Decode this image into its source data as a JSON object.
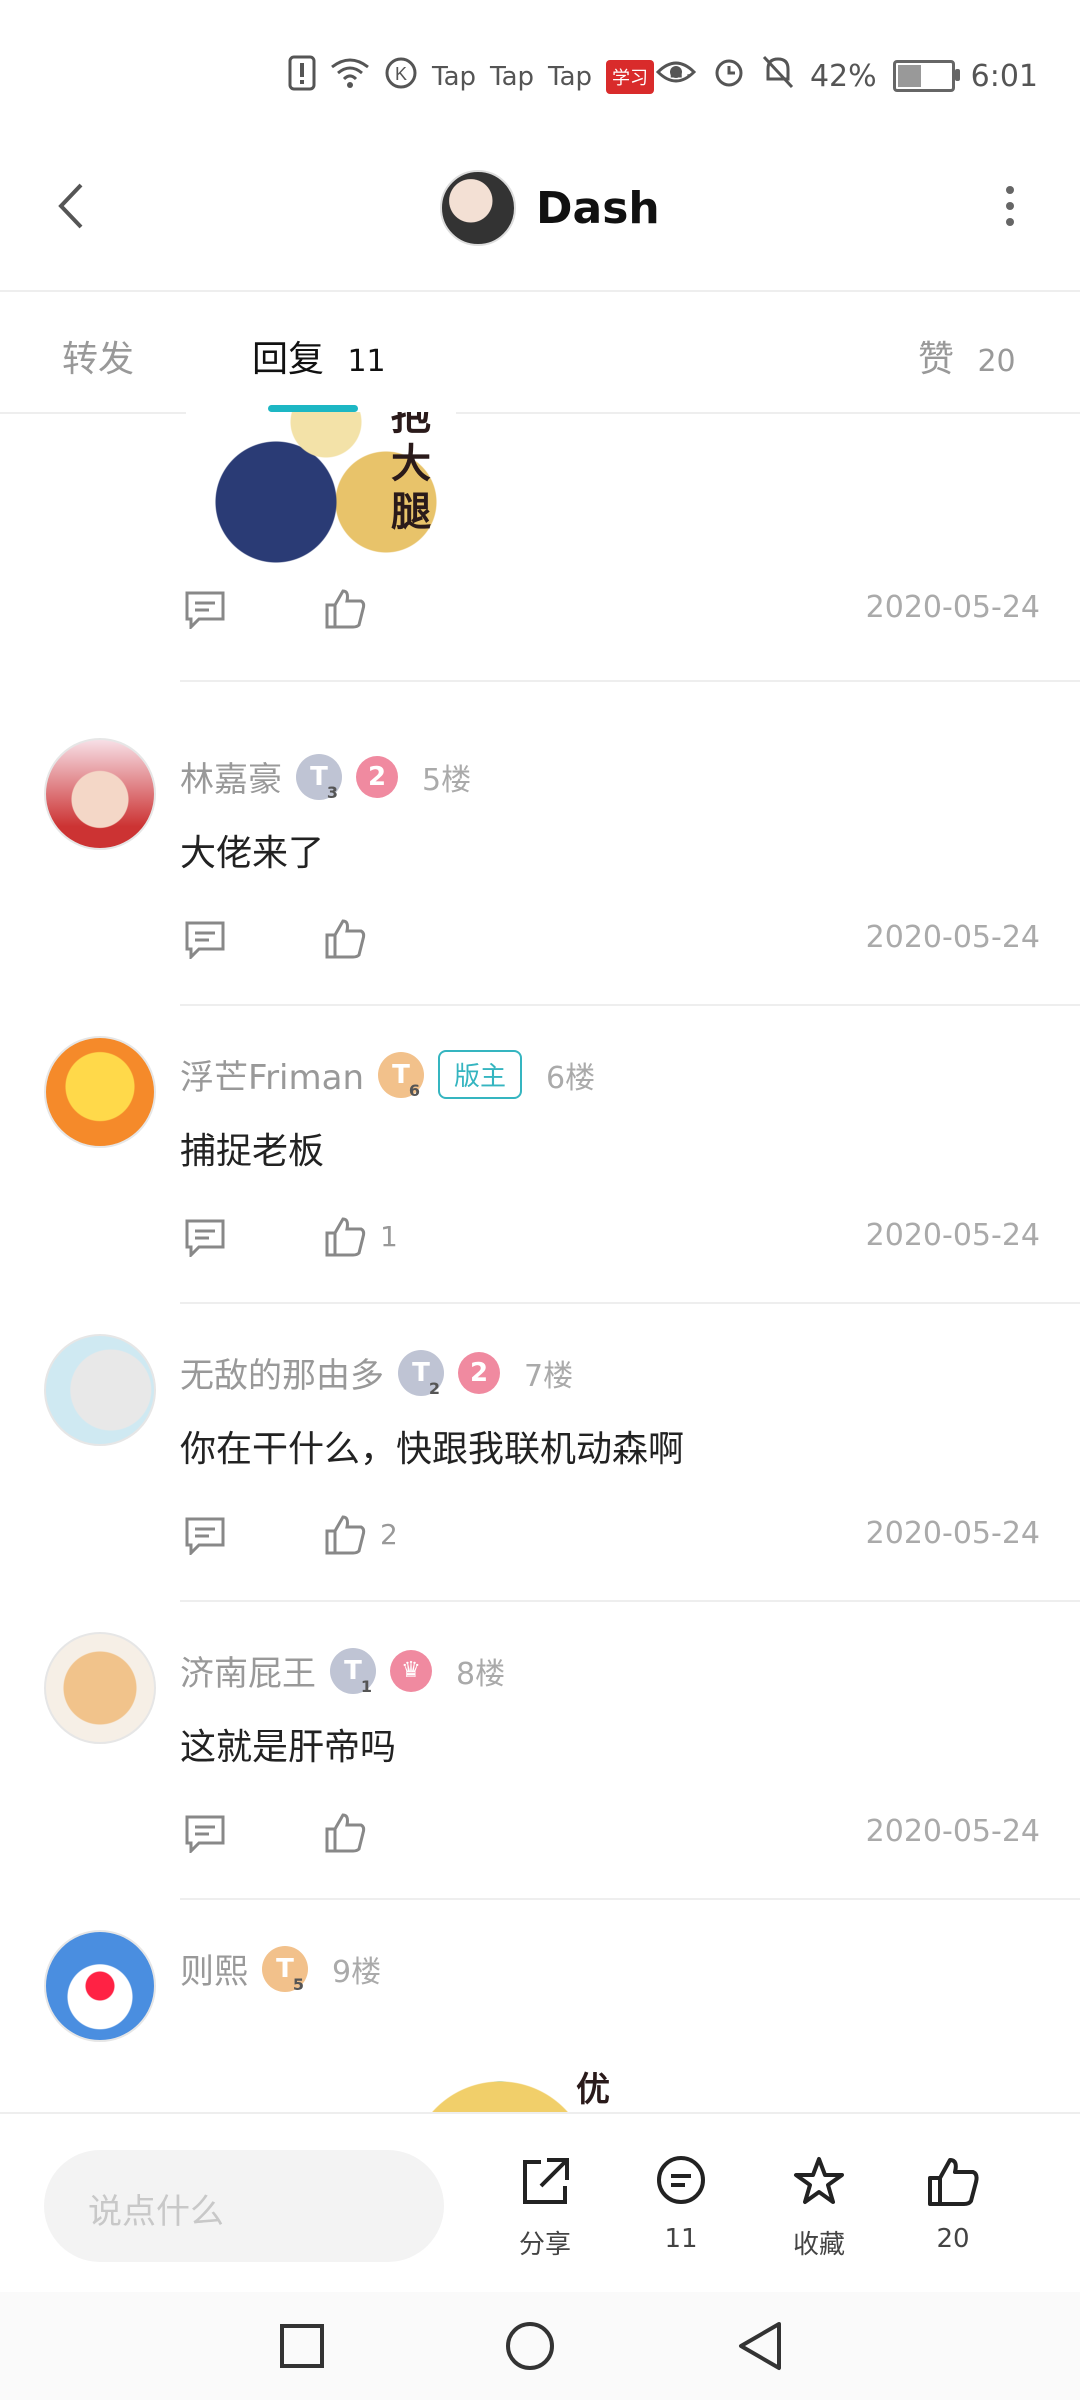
{
  "status_bar": {
    "apps": [
      "Tap",
      "Tap",
      "Tap"
    ],
    "red_app": "学习",
    "more": "···",
    "battery": "42%",
    "time": "6:01"
  },
  "header": {
    "title": "Dash"
  },
  "tabs": {
    "forward": "转发",
    "reply": "回复",
    "reply_count": "11",
    "like": "赞",
    "like_count": "20"
  },
  "top_post": {
    "sticker_text": "抱大腿",
    "date": "2020-05-24"
  },
  "comments": [
    {
      "name": "林嘉豪",
      "level": "3",
      "badge": "2",
      "floor": "5楼",
      "text": "大佬来了",
      "likes": "",
      "date": "2020-05-24"
    },
    {
      "name": "浮芒Friman",
      "level": "6",
      "badge": "版主",
      "floor": "6楼",
      "text": "捕捉老板",
      "likes": "1",
      "date": "2020-05-24"
    },
    {
      "name": "无敌的那由多",
      "level": "2",
      "badge": "2",
      "floor": "7楼",
      "text": "你在干什么，快跟我联机动森啊",
      "likes": "2",
      "date": "2020-05-24"
    },
    {
      "name": "济南屁王",
      "level": "1",
      "badge": "crown",
      "floor": "8楼",
      "text": "这就是肝帝吗",
      "likes": "",
      "date": "2020-05-24"
    },
    {
      "name": "则熙",
      "level": "5",
      "floor": "9楼",
      "sticker_text": "优"
    }
  ],
  "bottom_bar": {
    "input_placeholder": "说点什么",
    "share": "分享",
    "reply_count": "11",
    "collect": "收藏",
    "like_count": "20"
  },
  "colors": {
    "accent": "#1db7c4",
    "badge_pink": "#f08aa0",
    "text_gray": "#999999"
  }
}
